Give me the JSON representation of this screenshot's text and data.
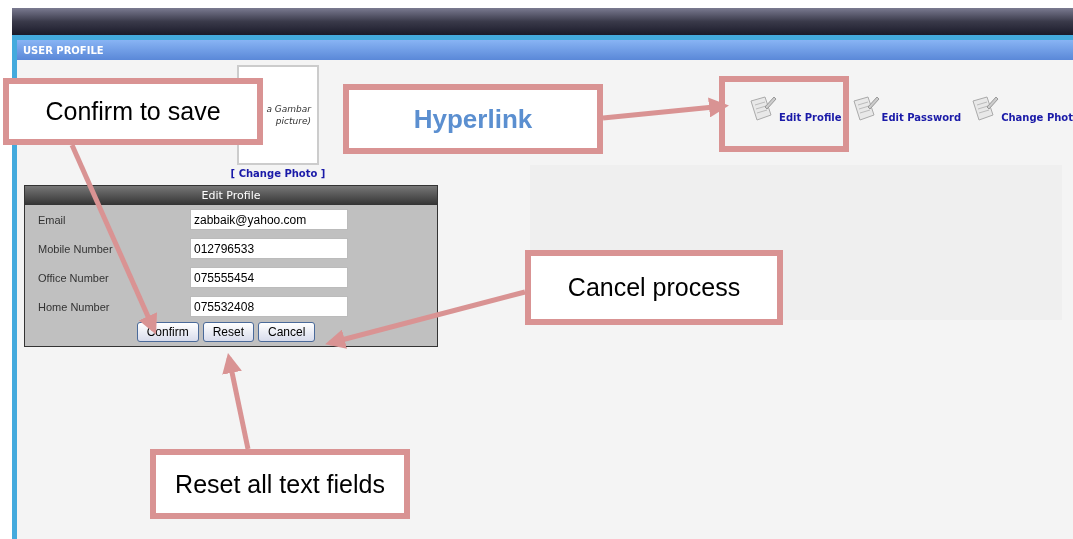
{
  "header": {
    "title": "USER PROFILE"
  },
  "photo": {
    "caption_lines": [
      "a Gambar",
      "picture)"
    ],
    "change_link": "[ Change Photo ]"
  },
  "links": [
    {
      "label": "Edit Profile",
      "highlighted": true
    },
    {
      "label": "Edit Password",
      "highlighted": false
    },
    {
      "label": "Change Phot",
      "highlighted": false
    }
  ],
  "form": {
    "title": "Edit Profile",
    "fields": [
      {
        "label": "Email",
        "value": "zabbaik@yahoo.com"
      },
      {
        "label": "Mobile Number",
        "value": "012796533"
      },
      {
        "label": "Office Number",
        "value": "075555454"
      },
      {
        "label": "Home Number",
        "value": "075532408"
      }
    ],
    "buttons": [
      "Confirm",
      "Reset",
      "Cancel"
    ]
  },
  "callouts": [
    {
      "text": "Confirm to save",
      "kind": "plain"
    },
    {
      "text": "Hyperlink",
      "kind": "accent"
    },
    {
      "text": "Cancel process",
      "kind": "plain"
    },
    {
      "text": "Reset all text fields",
      "kind": "plain"
    }
  ]
}
